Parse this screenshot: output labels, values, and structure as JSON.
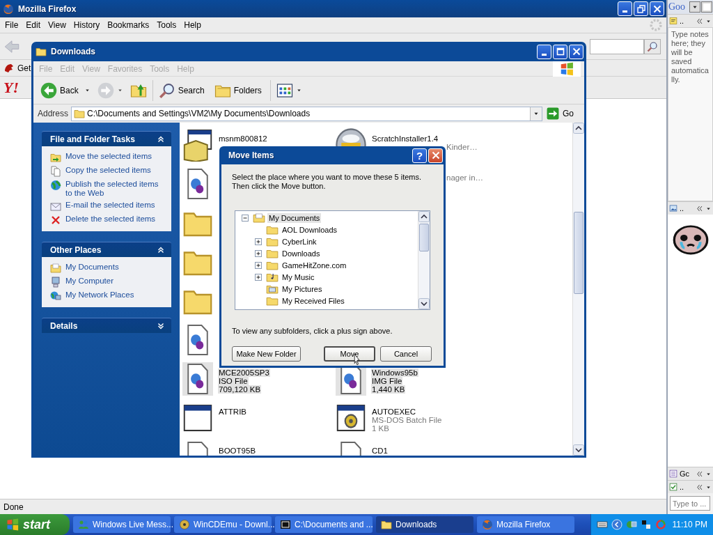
{
  "firefox": {
    "title": "Mozilla Firefox",
    "menu": [
      "File",
      "Edit",
      "View",
      "History",
      "Bookmarks",
      "Tools",
      "Help"
    ],
    "bookmark": "Get",
    "logo": "Y!",
    "status": "Done"
  },
  "explorer": {
    "title": "Downloads",
    "menu": [
      "File",
      "Edit",
      "View",
      "Favorites",
      "Tools",
      "Help"
    ],
    "toolbar": [
      {
        "kind": "back",
        "label": "Back"
      },
      {
        "kind": "forward"
      },
      {
        "kind": "up"
      },
      {
        "kind": "search",
        "label": "Search"
      },
      {
        "kind": "folders",
        "label": "Folders"
      },
      {
        "kind": "views"
      }
    ],
    "address_label": "Address",
    "address": "C:\\Documents and Settings\\VM2\\My Documents\\Downloads",
    "go": "Go",
    "panels": [
      {
        "title": "File and Folder Tasks",
        "expanded": true,
        "items": [
          {
            "kind": "move",
            "label": "Move the selected items"
          },
          {
            "kind": "copy",
            "label": "Copy the selected items"
          },
          {
            "kind": "publish",
            "label": "Publish the selected items to the Web"
          },
          {
            "kind": "email",
            "label": "E-mail the selected items"
          },
          {
            "kind": "delete",
            "label": "Delete the selected items"
          }
        ]
      },
      {
        "title": "Other Places",
        "expanded": true,
        "items": [
          {
            "kind": "mydocs",
            "label": "My Documents"
          },
          {
            "kind": "computer",
            "label": "My Computer"
          },
          {
            "kind": "network",
            "label": "My Network Places"
          }
        ]
      },
      {
        "title": "Details",
        "expanded": false
      }
    ],
    "rows": [
      {
        "left": {
          "kind": "installer",
          "selected": false,
          "lines": [
            {
              "text": "msnm800812",
              "kind": "name"
            }
          ]
        },
        "right": {
          "kind": "cd",
          "selected": false,
          "lines": [
            {
              "text": "ScratchInstaller1.4",
              "kind": "name"
            },
            {
              "text": "Kinder…",
              "kind": "fragment"
            }
          ]
        }
      },
      {
        "left": {
          "kind": "document",
          "selected": false
        },
        "right": {
          "kind": "hidden",
          "selected": false,
          "lines": [
            {
              "text": "nager in…",
              "kind": "fragment"
            }
          ]
        }
      },
      {
        "left": {
          "kind": "folder",
          "selected": false
        }
      },
      {
        "left": {
          "kind": "folder",
          "selected": false
        }
      },
      {
        "left": {
          "kind": "folder",
          "selected": false
        }
      },
      {
        "left": {
          "kind": "document",
          "selected": false
        }
      },
      {
        "left": {
          "kind": "document",
          "selected": true,
          "lines": [
            {
              "text": "MCE2005SP3",
              "kind": "name"
            },
            {
              "text": "ISO File",
              "kind": "detail"
            },
            {
              "text": "709,120 KB",
              "kind": "detail"
            }
          ]
        },
        "right": {
          "kind": "document",
          "selected": true,
          "lines": [
            {
              "text": "Windows95b",
              "kind": "name"
            },
            {
              "text": "IMG File",
              "kind": "detail"
            },
            {
              "text": "1,440 KB",
              "kind": "detail"
            }
          ]
        }
      },
      {
        "left": {
          "kind": "window",
          "selected": false,
          "lines": [
            {
              "text": "ATTRIB",
              "kind": "name"
            }
          ]
        },
        "right": {
          "kind": "batch",
          "selected": false,
          "lines": [
            {
              "text": "AUTOEXEC",
              "kind": "name"
            },
            {
              "text": "MS-DOS Batch File",
              "kind": "detail"
            },
            {
              "text": "1 KB",
              "kind": "detail"
            }
          ]
        }
      },
      {
        "left": {
          "kind": "page",
          "selected": false,
          "lines": [
            {
              "text": "BOOT95B",
              "kind": "name"
            }
          ]
        },
        "right": {
          "kind": "page",
          "selected": false,
          "lines": [
            {
              "text": "CD1",
              "kind": "name"
            }
          ]
        }
      }
    ]
  },
  "dialog": {
    "title": "Move Items",
    "help": "?",
    "instructions": [
      "Select the place where you want to move these 5 items.",
      "Then click the Move button."
    ],
    "tree": [
      {
        "label": "My Documents",
        "kind": "mydocs",
        "has_children": true,
        "expanded": true,
        "selected": true,
        "children": [
          {
            "label": "AOL Downloads",
            "kind": "folder",
            "has_children": false,
            "expanded": false,
            "selected": false
          },
          {
            "label": "CyberLink",
            "kind": "folder",
            "has_children": true,
            "expanded": false,
            "selected": false
          },
          {
            "label": "Downloads",
            "kind": "folder",
            "has_children": true,
            "expanded": false,
            "selected": false
          },
          {
            "label": "GameHitZone.com",
            "kind": "folder",
            "has_children": true,
            "expanded": false,
            "selected": false
          },
          {
            "label": "My Music",
            "kind": "music",
            "has_children": true,
            "expanded": false,
            "selected": false
          },
          {
            "label": "My Pictures",
            "kind": "pictures",
            "has_children": false,
            "expanded": false,
            "selected": false
          },
          {
            "label": "My Received Files",
            "kind": "folder",
            "has_children": false,
            "expanded": false,
            "selected": false
          }
        ]
      }
    ],
    "hint": "To view any subfolders, click a plus sign above.",
    "buttons": [
      {
        "label": "Make New Folder",
        "kind": "normal"
      },
      {
        "label": "Move",
        "kind": "default"
      },
      {
        "label": "Cancel",
        "kind": "normal"
      }
    ]
  },
  "sidebar": {
    "logo": "Goo",
    "gadgets": [
      {
        "kind": "notes",
        "title": "..",
        "text": "Type notes here; they will be saved automatically."
      },
      {
        "kind": "picture",
        "title": ".."
      },
      {
        "kind": "list",
        "title": "Gc"
      },
      {
        "kind": "todo",
        "title": "..",
        "placeholder": "Type to ..."
      }
    ]
  },
  "taskbar": {
    "start": "start",
    "tasks": [
      {
        "kind": "people",
        "label": "Windows Live Mess...",
        "selected": false
      },
      {
        "kind": "disc",
        "label": "WinCDEmu - Downl...",
        "selected": false
      },
      {
        "kind": "archive",
        "label": "C:\\Documents and ...",
        "selected": false
      },
      {
        "kind": "folder",
        "label": "Downloads",
        "selected": true
      },
      {
        "kind": "firefox",
        "label": "Mozilla Firefox",
        "selected": false
      }
    ],
    "clock": "11:10 PM"
  }
}
